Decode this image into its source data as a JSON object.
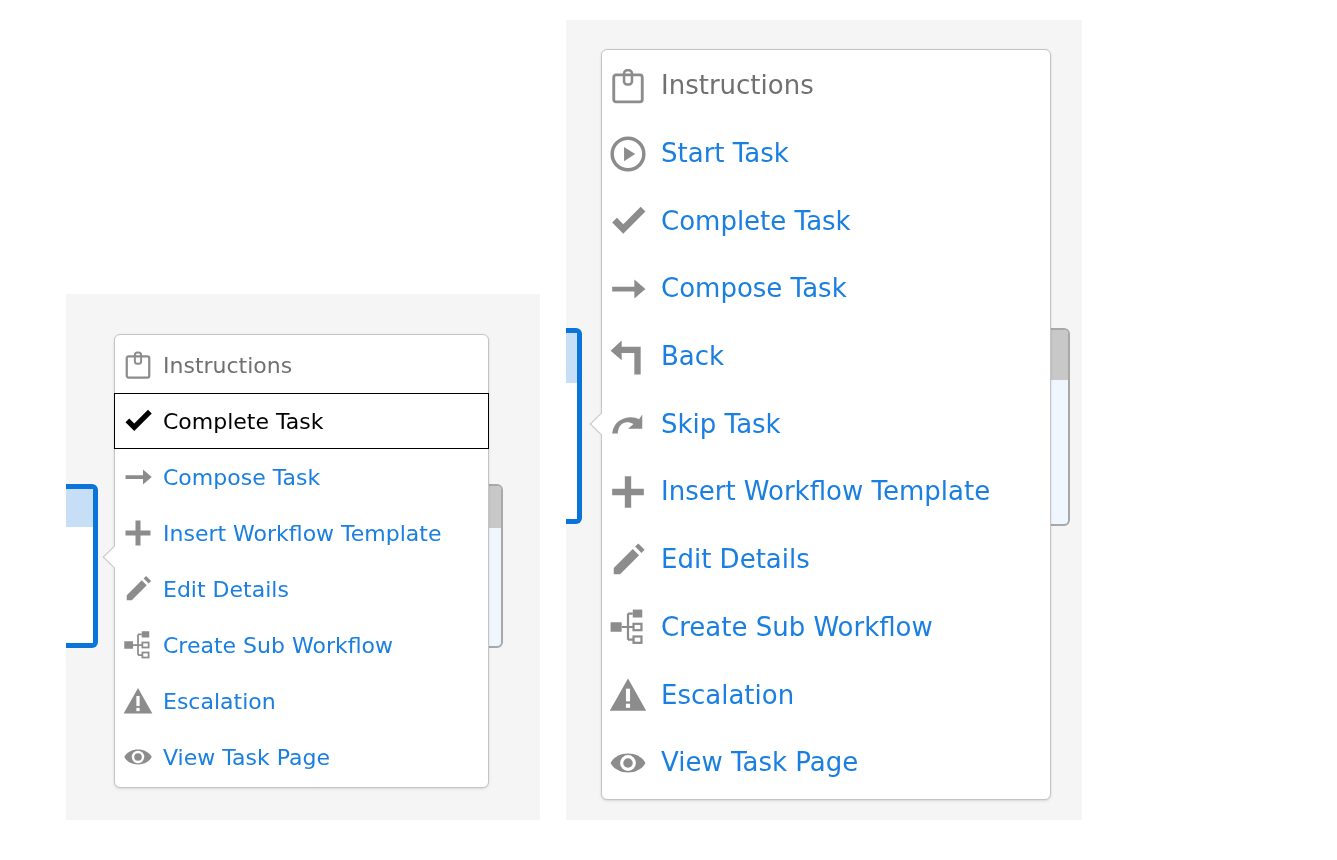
{
  "panels": [
    {
      "menu": {
        "items": [
          {
            "kind": "clipboard",
            "label": "Instructions",
            "selected": false
          },
          {
            "kind": "check",
            "label": "Complete Task",
            "selected": true
          },
          {
            "kind": "arrow",
            "label": "Compose Task",
            "selected": false
          },
          {
            "kind": "plus",
            "label": "Insert Workflow Template",
            "selected": false
          },
          {
            "kind": "pencil",
            "label": "Edit Details",
            "selected": false
          },
          {
            "kind": "hierarchy",
            "label": "Create Sub Workflow",
            "selected": false
          },
          {
            "kind": "warning",
            "label": "Escalation",
            "selected": false
          },
          {
            "kind": "eye",
            "label": "View Task Page",
            "selected": false
          }
        ]
      }
    },
    {
      "menu": {
        "items": [
          {
            "kind": "clipboard",
            "label": "Instructions",
            "selected": false
          },
          {
            "kind": "play",
            "label": "Start Task",
            "selected": false
          },
          {
            "kind": "check",
            "label": "Complete Task",
            "selected": false
          },
          {
            "kind": "arrow",
            "label": "Compose Task",
            "selected": false
          },
          {
            "kind": "back",
            "label": "Back",
            "selected": false
          },
          {
            "kind": "skip",
            "label": "Skip Task",
            "selected": false
          },
          {
            "kind": "plus",
            "label": "Insert Workflow Template",
            "selected": false
          },
          {
            "kind": "pencil",
            "label": "Edit Details",
            "selected": false
          },
          {
            "kind": "hierarchy",
            "label": "Create Sub Workflow",
            "selected": false
          },
          {
            "kind": "warning",
            "label": "Escalation",
            "selected": false
          },
          {
            "kind": "eye",
            "label": "View Task Page",
            "selected": false
          }
        ]
      }
    }
  ]
}
